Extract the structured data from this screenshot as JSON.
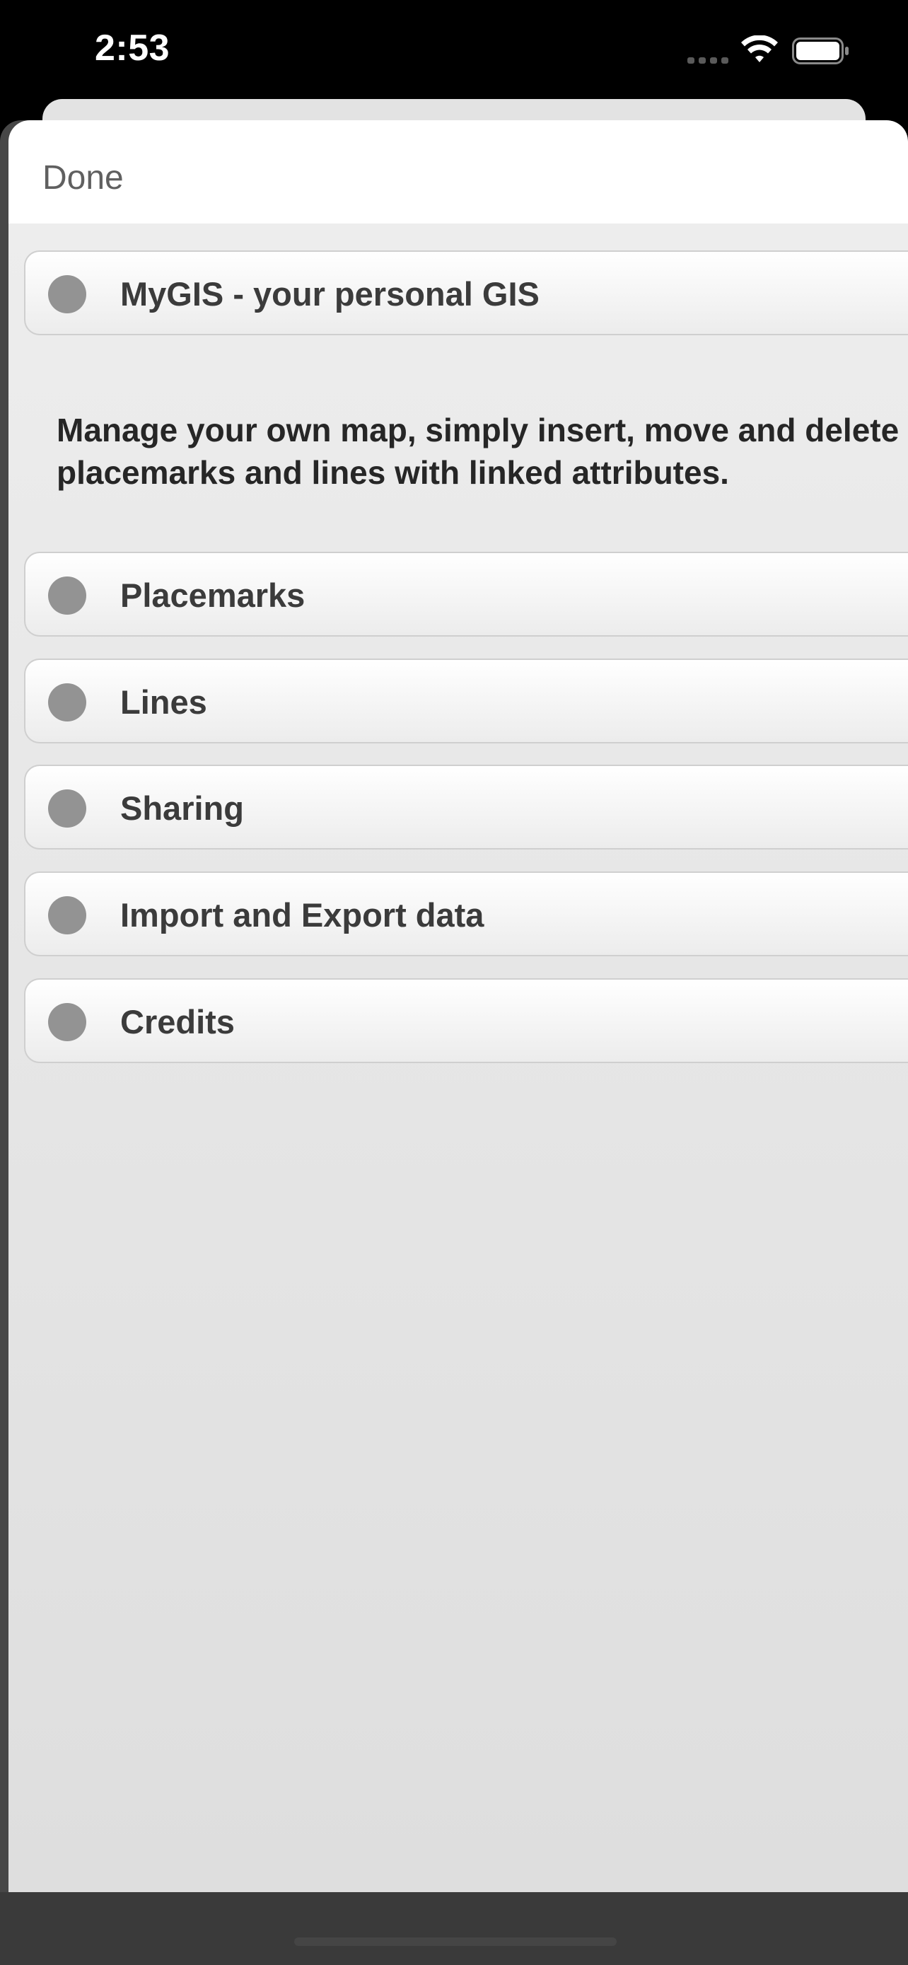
{
  "status_bar": {
    "time": "2:53",
    "icons": [
      "cellular-signal-icon",
      "wifi-icon",
      "battery-icon"
    ]
  },
  "header": {
    "done_label": "Done"
  },
  "title_row": {
    "label": "MyGIS - your personal GIS",
    "icon": "circle-bullet-icon"
  },
  "description": "Manage your own map, simply insert, move and delete placemarks and lines with linked attributes.",
  "menu": {
    "items": [
      {
        "label": "Placemarks",
        "icon": "circle-bullet-icon"
      },
      {
        "label": "Lines",
        "icon": "circle-bullet-icon"
      },
      {
        "label": "Sharing",
        "icon": "circle-bullet-icon"
      },
      {
        "label": "Import and Export data",
        "icon": "circle-bullet-icon"
      },
      {
        "label": "Credits",
        "icon": "circle-bullet-icon"
      }
    ]
  },
  "colors": {
    "row_dot": "#939393",
    "row_text": "#3b3b3b",
    "done_text": "#606060",
    "sheet_background": "#e6e6e6"
  }
}
